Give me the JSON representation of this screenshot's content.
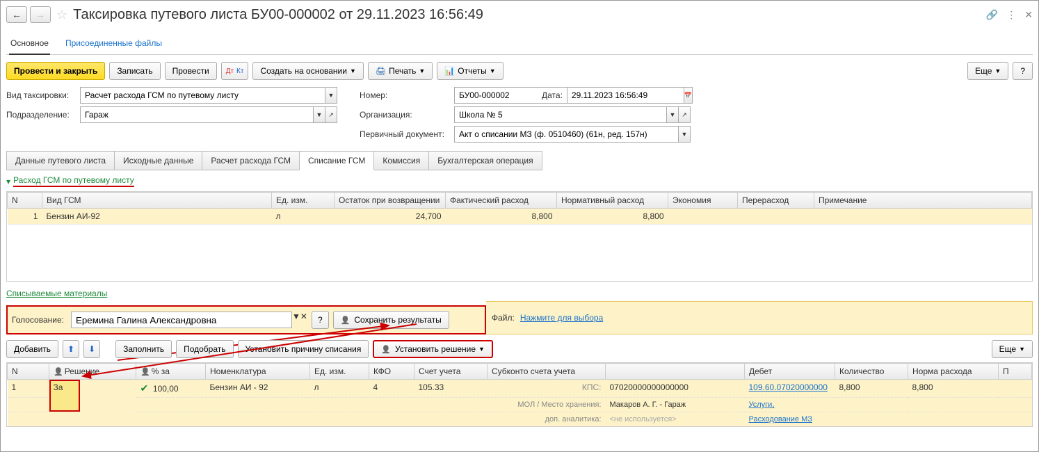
{
  "header": {
    "title": "Таксировка путевого листа БУ00-000002 от 29.11.2023 16:56:49"
  },
  "subnav": {
    "main": "Основное",
    "files": "Присоединенные файлы"
  },
  "toolbar": {
    "post_close": "Провести и закрыть",
    "save": "Записать",
    "post": "Провести",
    "create_based": "Создать на основании",
    "print": "Печать",
    "reports": "Отчеты",
    "more": "Еще",
    "help": "?"
  },
  "form": {
    "vid_label": "Вид таксировки:",
    "vid_value": "Расчет расхода ГСМ по путевому листу",
    "number_label": "Номер:",
    "number_value": "БУ00-000002",
    "date_label": "Дата:",
    "date_value": "29.11.2023 16:56:49",
    "podr_label": "Подразделение:",
    "podr_value": "Гараж",
    "org_label": "Организация:",
    "org_value": "Школа № 5",
    "primdoc_label": "Первичный документ:",
    "primdoc_value": "Акт о списании МЗ (ф. 0510460) (61н, ред. 157н)"
  },
  "tabs": [
    "Данные путевого листа",
    "Исходные данные",
    "Расчет расхода ГСМ",
    "Списание ГСМ",
    "Комиссия",
    "Бухгалтерская операция"
  ],
  "section1": "Расход ГСМ по путевому листу",
  "t1": {
    "cols": [
      "N",
      "Вид ГСМ",
      "Ед. изм.",
      "Остаток при возвращении",
      "Фактический расход",
      "Нормативный расход",
      "Экономия",
      "Перерасход",
      "Примечание"
    ],
    "rows": [
      {
        "n": "1",
        "vid": "Бензин АИ-92",
        "ed": "л",
        "ost": "24,700",
        "fact": "8,800",
        "norm": "8,800",
        "econ": "",
        "per": "",
        "prim": ""
      }
    ]
  },
  "section2": "Списываемые материалы",
  "vote": {
    "label": "Голосование:",
    "value": "Еремина Галина Александровна",
    "help": "?",
    "save": "Сохранить результаты",
    "file_label": "Файл:",
    "file_link": "Нажмите для выбора"
  },
  "actions": {
    "add": "Добавить",
    "fill": "Заполнить",
    "pick": "Подобрать",
    "reason": "Установить причину списания",
    "decision": "Установить решение",
    "more": "Еще"
  },
  "t2": {
    "cols": [
      "N",
      "Решение",
      "% за",
      "Номенклатура",
      "Ед. изм.",
      "КФО",
      "Счет учета",
      "Субконто счета учета",
      "",
      "Дебет",
      "Количество",
      "Норма расхода",
      "П"
    ],
    "row": {
      "n": "1",
      "decision": "За",
      "percent": "100,00",
      "nom": "Бензин АИ - 92",
      "ed": "л",
      "kfo": "4",
      "acct": "105.33",
      "sub1_label": "КПС:",
      "sub1_val": "07020000000000000",
      "sub2_label": "МОЛ / Место хранения:",
      "sub2_val": "Макаров А. Г. - Гараж",
      "sub3_label": "доп. аналитика:",
      "sub3_val": "<не используется>",
      "debit_main": "109.60.07020000000",
      "debit_l2": "Услуги,",
      "debit_l3": "Расходование МЗ",
      "qty": "8,800",
      "norm": "8,800"
    }
  }
}
